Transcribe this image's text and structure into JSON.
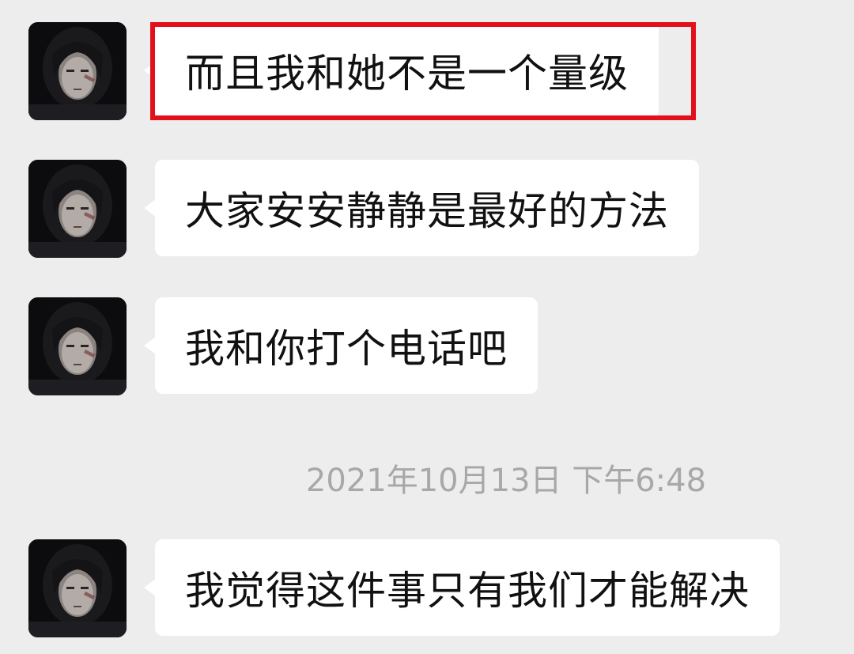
{
  "conversation": {
    "messages": [
      {
        "text": "而且我和她不是一个量级",
        "avatar": "profile-avatar",
        "highlighted": true
      },
      {
        "text": "大家安安静静是最好的方法",
        "avatar": "profile-avatar",
        "highlighted": false
      },
      {
        "text": "我和你打个电话吧",
        "avatar": "profile-avatar",
        "highlighted": false
      },
      {
        "text": "我觉得这件事只有我们才能解决",
        "avatar": "profile-avatar",
        "highlighted": false
      }
    ],
    "timestamp": "2021年10月13日 下午6:48"
  },
  "colors": {
    "background": "#ededed",
    "bubble": "#ffffff",
    "highlight_border": "#e3101b",
    "timestamp_text": "#a8a8a8"
  }
}
